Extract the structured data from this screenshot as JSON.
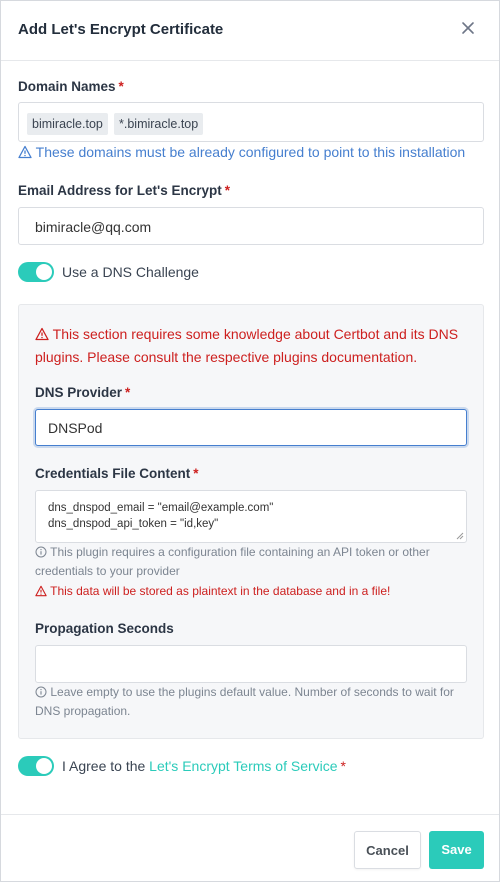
{
  "modal": {
    "title": "Add Let's Encrypt Certificate",
    "close_icon": "close-icon"
  },
  "domains": {
    "label": "Domain Names",
    "required_mark": "*",
    "tags": [
      "bimiracle.top",
      "*.bimiracle.top"
    ],
    "info": "These domains must be already configured to point to this installation"
  },
  "email": {
    "label": "Email Address for Let's Encrypt",
    "required_mark": "*",
    "value": "bimiracle@qq.com"
  },
  "dns_toggle": {
    "label": "Use a DNS Challenge",
    "checked": true
  },
  "dns_section": {
    "warning": "This section requires some knowledge about Certbot and its DNS plugins. Please consult the respective plugins documentation.",
    "provider_label": "DNS Provider",
    "provider_required": "*",
    "provider_value": "DNSPod",
    "credentials_label": "Credentials File Content",
    "credentials_required": "*",
    "credentials_value": "dns_dnspod_email = \"email@example.com\"\ndns_dnspod_api_token = \"id,key\"",
    "credentials_help": "This plugin requires a configuration file containing an API token or other credentials to your provider",
    "credentials_warning": "This data will be stored as plaintext in the database and in a file!",
    "propagation_label": "Propagation Seconds",
    "propagation_value": "",
    "propagation_help": "Leave empty to use the plugins default value. Number of seconds to wait for DNS propagation."
  },
  "agree": {
    "prefix": "I Agree to the ",
    "link": "Let's Encrypt Terms of Service",
    "required_mark": "*",
    "checked": true
  },
  "footer": {
    "cancel_label": "Cancel",
    "save_label": "Save"
  },
  "colors": {
    "accent": "#2bcbba",
    "danger": "#cd201f",
    "info": "#467fcf"
  }
}
